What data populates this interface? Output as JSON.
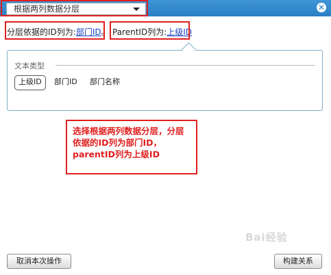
{
  "titlebar": {
    "mode_select_value": "根据两列数据分层",
    "close_symbol": "✕"
  },
  "settings": {
    "id_column_prefix": "分层依据的ID列为:",
    "id_column_value": "部门ID",
    "id_column_suffix": "。",
    "parent_column_prefix": "ParentID列为:",
    "parent_column_value": "上级ID"
  },
  "popover": {
    "group_title": "文本类型",
    "options": [
      {
        "label": "上级ID",
        "selected": true
      },
      {
        "label": "部门ID",
        "selected": false
      },
      {
        "label": "部门名称",
        "selected": false
      }
    ]
  },
  "annotation": {
    "text": "选择根据两列数据分层，分层依据的ID列为部门ID，parentID列为上级ID"
  },
  "footer": {
    "cancel_label": "取消本次操作",
    "build_label": "构建关系"
  },
  "watermark": {
    "text": "Bai经验"
  },
  "colors": {
    "titlebar": "#2b7fc4",
    "annotation_red": "#e01e1e",
    "link": "#1a3fbf"
  }
}
